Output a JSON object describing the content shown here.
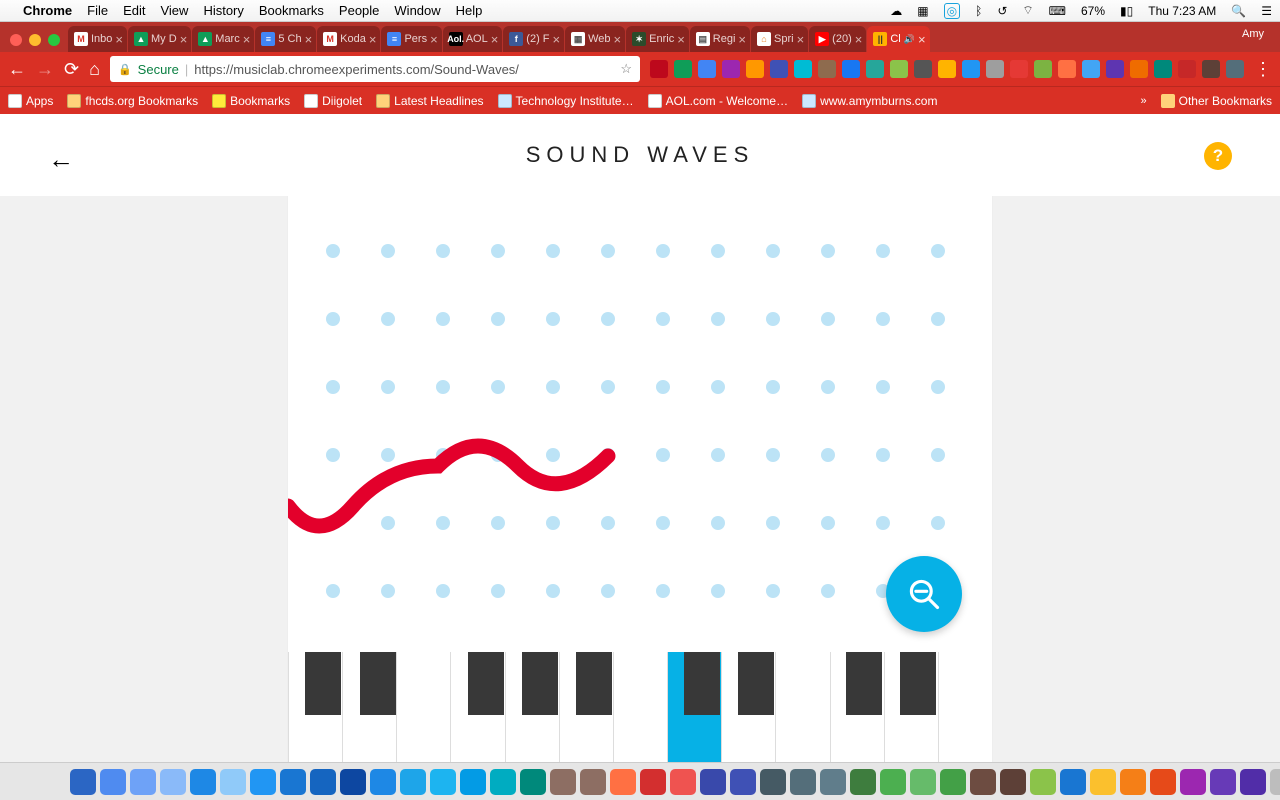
{
  "mac_menu": {
    "app": "Chrome",
    "items": [
      "File",
      "Edit",
      "View",
      "History",
      "Bookmarks",
      "People",
      "Window",
      "Help"
    ],
    "battery": "67%",
    "clock": "Thu 7:23 AM"
  },
  "chrome": {
    "user": "Amy",
    "tabs": [
      {
        "label": "Inbo",
        "fav_bg": "#fff",
        "fav_txt": "M",
        "fav_color": "#d93025"
      },
      {
        "label": "My D",
        "fav_bg": "#0f9d58",
        "fav_txt": "▲",
        "fav_color": "#fff"
      },
      {
        "label": "Marc",
        "fav_bg": "#0f9d58",
        "fav_txt": "▲",
        "fav_color": "#fff"
      },
      {
        "label": "5 Ch",
        "fav_bg": "#4285f4",
        "fav_txt": "≡",
        "fav_color": "#fff"
      },
      {
        "label": "Koda",
        "fav_bg": "#fff",
        "fav_txt": "M",
        "fav_color": "#d93025"
      },
      {
        "label": "Pers",
        "fav_bg": "#4285f4",
        "fav_txt": "≡",
        "fav_color": "#fff"
      },
      {
        "label": "AOL",
        "fav_bg": "#000",
        "fav_txt": "Aol.",
        "fav_color": "#fff"
      },
      {
        "label": "(2) F",
        "fav_bg": "#3b5998",
        "fav_txt": "f",
        "fav_color": "#fff"
      },
      {
        "label": "Web",
        "fav_bg": "#fff",
        "fav_txt": "▦",
        "fav_color": "#555"
      },
      {
        "label": "Enric",
        "fav_bg": "#2b4b2b",
        "fav_txt": "✶",
        "fav_color": "#fff"
      },
      {
        "label": "Regi",
        "fav_bg": "#fff",
        "fav_txt": "▤",
        "fav_color": "#555"
      },
      {
        "label": "Spri",
        "fav_bg": "#fff",
        "fav_txt": "⌂",
        "fav_color": "#e67e22"
      },
      {
        "label": "(20)",
        "fav_bg": "#f00",
        "fav_txt": "▶",
        "fav_color": "#fff"
      },
      {
        "label": "Cl",
        "fav_bg": "#ffb400",
        "fav_txt": "||",
        "fav_color": "#333",
        "active": true,
        "sound": true
      }
    ],
    "toolbar": {
      "secure_label": "Secure",
      "url": "https://musiclab.chromeexperiments.com/Sound-Waves/"
    },
    "extensions_colors": [
      "#bd081c",
      "#0f9d58",
      "#4285f4",
      "#9c27b0",
      "#ff9800",
      "#3f51b5",
      "#00bcd4",
      "#8e6b4e",
      "#1877f2",
      "#26a69a",
      "#8bc34a",
      "#555",
      "#ffb400",
      "#2196f3",
      "#9e9e9e",
      "#e53935",
      "#7cb342",
      "#ff7043",
      "#42a5f5",
      "#5e35b1",
      "#ef6c00",
      "#00897b",
      "#c62828",
      "#5d4037",
      "#546e7a"
    ],
    "bookmarks": [
      {
        "label": "Apps",
        "color": "#fff"
      },
      {
        "label": "fhcds.org Bookmarks",
        "color": "#ffd27a"
      },
      {
        "label": "Bookmarks",
        "color": "#ffeb3b"
      },
      {
        "label": "Diigolet",
        "color": "#fff"
      },
      {
        "label": "Latest Headlines",
        "color": "#ffd27a"
      },
      {
        "label": "Technology Institute…",
        "color": "#cce8ff"
      },
      {
        "label": "AOL.com - Welcome…",
        "color": "#fff"
      },
      {
        "label": "www.amymburns.com",
        "color": "#cce8ff"
      }
    ],
    "other_bookmarks": "Other Bookmarks"
  },
  "page": {
    "title": "SOUND WAVES",
    "help": "?",
    "zoom_icon": "zoom-out",
    "active_white_key_index": 7,
    "black_key_positions_pct": [
      5.0,
      12.8,
      28.1,
      35.8,
      43.5,
      58.8,
      66.5,
      81.8,
      89.5
    ]
  },
  "dock_colors": [
    "#2b66c4",
    "#4f8bf0",
    "#6ea2f7",
    "#8abaf9",
    "#1e88e5",
    "#90caf9",
    "#2196f3",
    "#1976d2",
    "#1565c0",
    "#0d47a1",
    "#1e88e5",
    "#1ea5e9",
    "#1db4f0",
    "#039be5",
    "#00acc1",
    "#00897b",
    "#8d6e63",
    "#8d6e63",
    "#ff7043",
    "#d32f2f",
    "#ef5350",
    "#3949ab",
    "#3f51b5",
    "#455a64",
    "#546e7a",
    "#607d8b",
    "#3e7d3e",
    "#4caf50",
    "#66bb6a",
    "#43a047",
    "#6d4c41",
    "#5d4037",
    "#8bc34a",
    "#1976d2",
    "#fbc02d",
    "#f57f17",
    "#e64a19",
    "#9c27b0",
    "#673ab7",
    "#512da8",
    "#bdbdbd",
    "#9e9e9e",
    "#757575",
    "#616161",
    "#424242",
    "#795548",
    "#607d8b"
  ]
}
